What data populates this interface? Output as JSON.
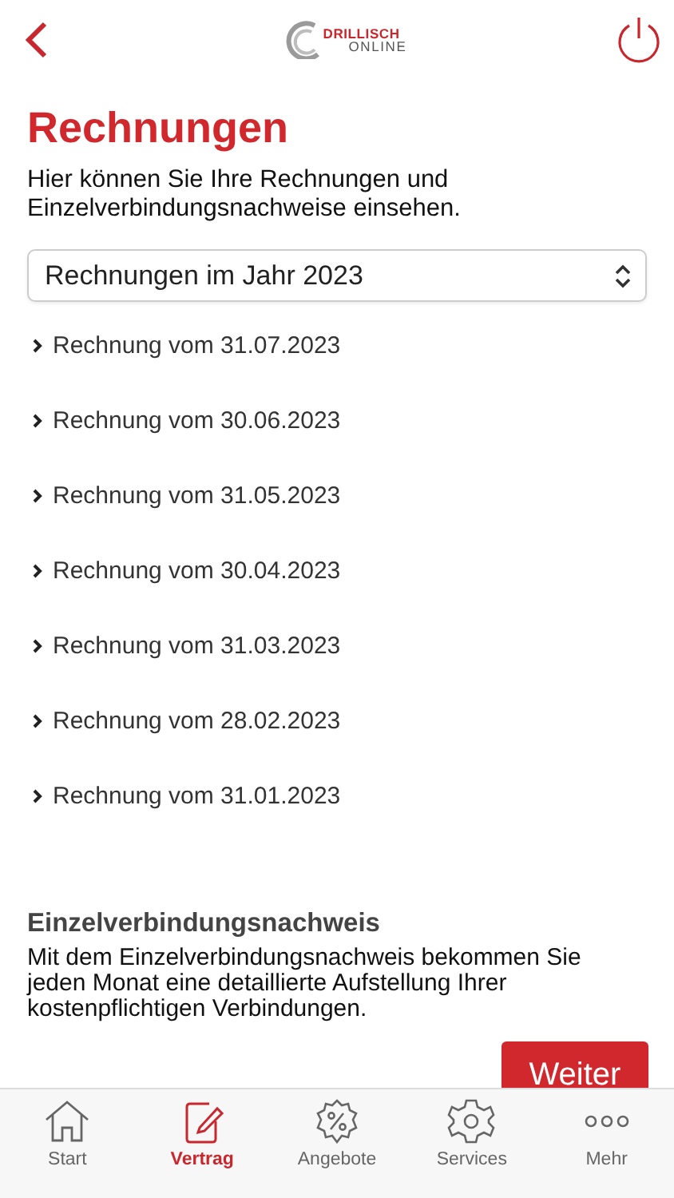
{
  "header": {
    "logo": {
      "line_1": "DRILLISCH",
      "line_2": "ONLINE"
    }
  },
  "title": "Rechnungen",
  "intro": "Hier können Sie Ihre Rechnungen und Einzelverbindungsnachweise einsehen.",
  "year_select": {
    "value": "Rechnungen im Jahr 2023"
  },
  "invoices": [
    {
      "label": "Rechnung vom 31.07.2023"
    },
    {
      "label": "Rechnung vom 30.06.2023"
    },
    {
      "label": "Rechnung vom 31.05.2023"
    },
    {
      "label": "Rechnung vom 30.04.2023"
    },
    {
      "label": "Rechnung vom 31.03.2023"
    },
    {
      "label": "Rechnung vom 28.02.2023"
    },
    {
      "label": "Rechnung vom 31.01.2023"
    }
  ],
  "evn_section": {
    "title": "Einzelverbindungsnachweis",
    "text": "Mit dem Einzelverbindungsnachweis bekommen Sie jeden Monat eine detaillierte Aufstellung Ihrer kostenpflichtigen Verbindungen.",
    "button": "Weiter"
  },
  "tab_bar": [
    {
      "label": "Start",
      "kind": "home",
      "selected": false
    },
    {
      "label": "Vertrag",
      "kind": "contract",
      "selected": true
    },
    {
      "label": "Angebote",
      "kind": "offers",
      "selected": false
    },
    {
      "label": "Services",
      "kind": "services",
      "selected": false
    },
    {
      "label": "Mehr",
      "kind": "more",
      "selected": false
    }
  ]
}
